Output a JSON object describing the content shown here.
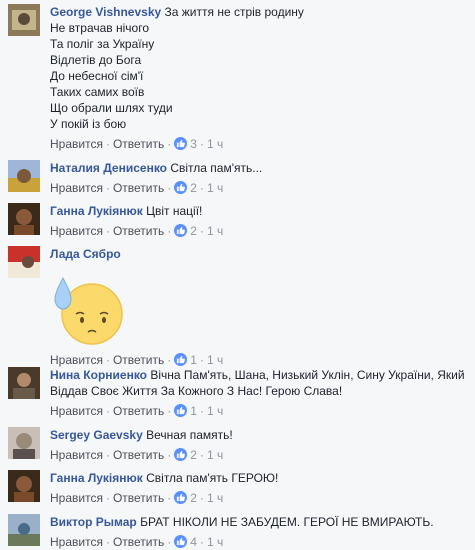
{
  "comments": [
    {
      "name": "George Vishnevsky",
      "lines": [
        "За життя не стрів родину",
        "Не втрачав нічого",
        "Та поліг за Україну",
        "Відлетів до Бога",
        "До небесної сім'ї",
        "Таких самих воїв",
        "Що обрали шлях туди",
        "У покій із бою"
      ],
      "like_label": "Нравится",
      "reply_label": "Ответить",
      "likes": "3",
      "time": "1 ч",
      "avatar_color": "#8a7a5a"
    },
    {
      "name": "Наталия Денисенко",
      "lines": [
        "Світла пам'ять..."
      ],
      "like_label": "Нравится",
      "reply_label": "Ответить",
      "likes": "2",
      "time": "1 ч",
      "avatar_color": "#c9a23a"
    },
    {
      "name": "Ганна Лукіянюк",
      "lines": [
        "Цвіт нації!"
      ],
      "like_label": "Нравится",
      "reply_label": "Ответить",
      "likes": "2",
      "time": "1 ч",
      "avatar_color": "#7a4a2a"
    },
    {
      "name": "Лада Сябро",
      "lines": [
        ""
      ],
      "like_label": "Нравится",
      "reply_label": "Ответить",
      "likes": "1",
      "time": "1 ч",
      "avatar_color": "#c8322a",
      "sticker": "sad-emoji-sticker"
    },
    {
      "name": "Нина Корниенко",
      "lines": [
        "Вічна Пам'ять, Шана, Низький Уклін, Сину України, Який",
        "Віддав Своє Життя За Кожного З Нас! Герою Слава!"
      ],
      "like_label": "Нравится",
      "reply_label": "Ответить",
      "likes": "1",
      "time": "1 ч",
      "avatar_color": "#6a5a4a"
    },
    {
      "name": "Sergey Gaevsky",
      "lines": [
        "Вечная память!"
      ],
      "like_label": "Нравится",
      "reply_label": "Ответить",
      "likes": "2",
      "time": "1 ч",
      "avatar_color": "#9a8a7a"
    },
    {
      "name": "Ганна Лукіянюк",
      "lines": [
        "Світла пам'ять ГЕРОЮ!"
      ],
      "like_label": "Нравится",
      "reply_label": "Ответить",
      "likes": "2",
      "time": "1 ч",
      "avatar_color": "#7a4a2a"
    },
    {
      "name": "Виктор Рымар",
      "lines": [
        "БРАТ НІКОЛИ НЕ ЗАБУДЕМ. ГЕРОЇ НЕ ВМИРАЮТЬ."
      ],
      "like_label": "Нравится",
      "reply_label": "Ответить",
      "likes": "4",
      "time": "1 ч",
      "avatar_color": "#4a6a8a"
    }
  ],
  "like_color": "#5890ff",
  "name_color": "#365899"
}
